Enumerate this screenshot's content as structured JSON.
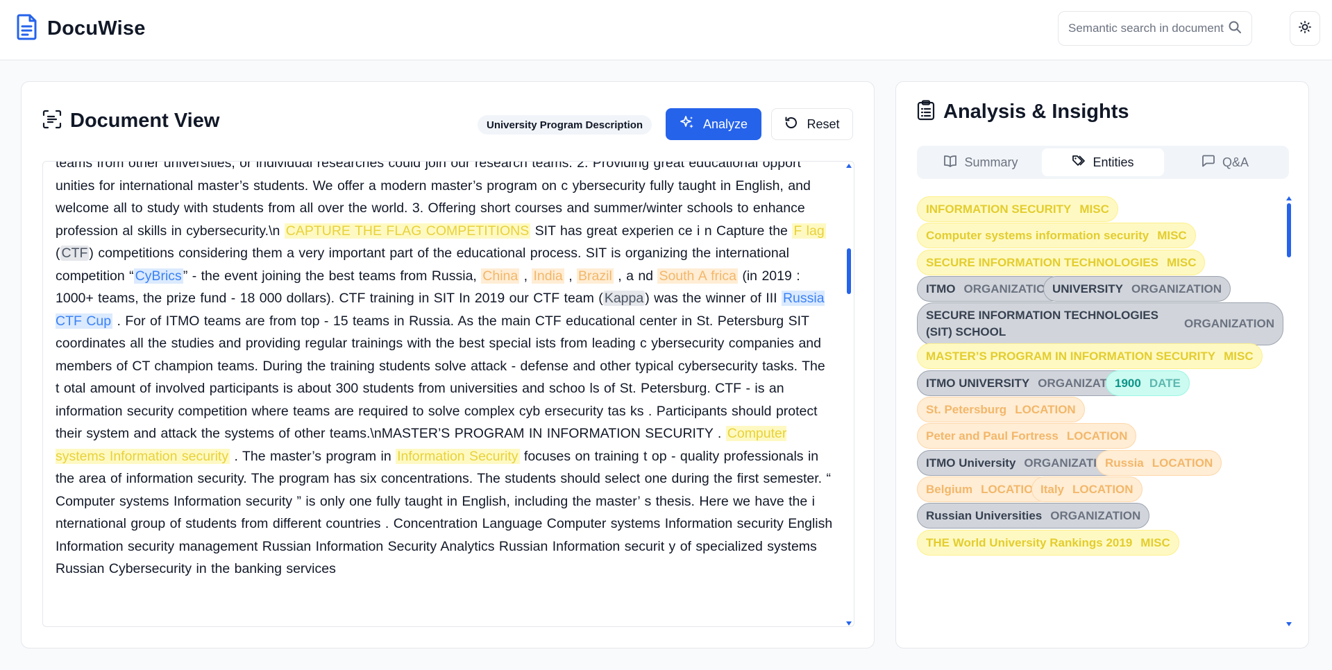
{
  "app": {
    "name": "DocuWise"
  },
  "search": {
    "placeholder": "Semantic search in document"
  },
  "document": {
    "title": "Document View",
    "badge": "University Program Description",
    "analyze_label": "Analyze",
    "reset_label": "Reset",
    "segments": [
      {
        "t": "teams from other  universities, or individual researches could join our research teams.  2.   Providing   great  educational   opport unities   for   international   master’s  students. We offer a   modern master’s program on c ybersecurity   fully  taught in English, and welcome all to study with students from all over the  world.  3.   Offering  short   courses   and   summer/winter   schools   to   enhance  profession al skills in cybersecurity.\\n "
      },
      {
        "t": "CAPTURE THE FLAG COMPETITIONS",
        "c": "misc"
      },
      {
        "t": "  SIT has great experien ce i n Capture the  "
      },
      {
        "t": " F lag ",
        "c": "misc"
      },
      {
        "t": "  ("
      },
      {
        "t": "CTF",
        "c": "org"
      },
      {
        "t": ")   competitions considering them  a very important part of the educational process.  SIT is organizing the international competition “"
      },
      {
        "t": "CyBrics",
        "c": "blue"
      },
      {
        "t": "”   -   the event   joining   the best  teams from Russia,  "
      },
      {
        "t": "China",
        "c": "loc"
      },
      {
        "t": " ,  "
      },
      {
        "t": "India",
        "c": "loc"
      },
      {
        "t": " ,  "
      },
      {
        "t": "Brazil",
        "c": "loc"
      },
      {
        "t": " , a nd  "
      },
      {
        "t": "South A frica",
        "c": "loc"
      },
      {
        "t": "  (in   2019 : 1000+   teams,  the prize fund   -   18   000 dollars).  CTF training in SIT  In 2019 our CTF team  ("
      },
      {
        "t": "Kappa",
        "c": "org"
      },
      {
        "t": ") was the winner of III  "
      },
      {
        "t": "Russia CTF Cup",
        "c": "blue"
      },
      {
        "t": " .   For of ITMO  teams are from   top - 15 teams in Russia. As the main CTF educational center in St.  Petersburg SIT coordinates all the studies and providing regular trainings with   the  best special ists from leading c ybersecurity companies and members of   CT  champion   teams.   During   the   training students solve   attack - defense and other  typical cybersecurity tasks.  The t otal amount of involved participants is about 300 students from universities and schoo ls of St. Petersburg.  CTF   -   is an information security competition where   teams are required to solve complex cyb ersecurity tas ks . Participants should protect their system and  attack the systems of other teams.\\nMASTER’S   PROGRAM   IN INFORMATION SECURITY .   "
      },
      {
        "t": "Computer  systems Information security",
        "c": "misc"
      },
      {
        "t": "  .  The master’s   program   in  "
      },
      {
        "t": "Information Security",
        "c": "misc"
      },
      {
        "t": "  focuses on training   t op - quality  professionals in the area of information security.  The   program   has six concentrations. The students should select one during the  first semester. “ Computer systems Information security ” is only one fully taught in  English, including   the   master’ s thesis. Here we have   the   i nternational group of students  from different countries .  Concentration   Language Computer systems Information security   English  Information security   management   Russian  Information Security Analytics   Russian  Information securit y of specialized systems   Russian  Cybersecurity in the banking services"
      }
    ]
  },
  "insights": {
    "title": "Analysis & Insights",
    "tabs": [
      {
        "label": "Summary",
        "icon": "book-icon",
        "active": false
      },
      {
        "label": "Entities",
        "icon": "tag-icon",
        "active": true
      },
      {
        "label": "Q&A",
        "icon": "message-icon",
        "active": false
      }
    ],
    "entities": [
      {
        "name": "INFORMATION SECURITY",
        "type": "MISC"
      },
      {
        "name": "Computer systems information security",
        "type": "MISC"
      },
      {
        "name": "SECURE INFORMATION TECHNOLOGIES",
        "type": "MISC"
      },
      {
        "name": "ITMO",
        "type": "ORGANIZATION"
      },
      {
        "name": "UNIVERSITY",
        "type": "ORGANIZATION"
      },
      {
        "name": "SECURE INFORMATION TECHNOLOGIES (SIT) SCHOOL",
        "type": "ORGANIZATION"
      },
      {
        "name": "MASTER’S PROGRAM IN INFORMATION SECURITY",
        "type": "MISC"
      },
      {
        "name": "ITMO UNIVERSITY",
        "type": "ORGANIZATION"
      },
      {
        "name": "1900",
        "type": "DATE"
      },
      {
        "name": "St. Petersburg",
        "type": "LOCATION"
      },
      {
        "name": "Peter and Paul Fortress",
        "type": "LOCATION"
      },
      {
        "name": "ITMO University",
        "type": "ORGANIZATION"
      },
      {
        "name": "Russia",
        "type": "LOCATION"
      },
      {
        "name": "Belgium",
        "type": "LOCATION"
      },
      {
        "name": "Italy",
        "type": "LOCATION"
      },
      {
        "name": "Russian Universities",
        "type": "ORGANIZATION"
      },
      {
        "name": "THE World University Rankings 2019",
        "type": "MISC"
      }
    ]
  },
  "colors": {
    "accent": "#2563eb",
    "misc": "#fef9c3",
    "organization": "#d1d5db",
    "location": "#ffedd5",
    "date": "#ccfbf1"
  }
}
